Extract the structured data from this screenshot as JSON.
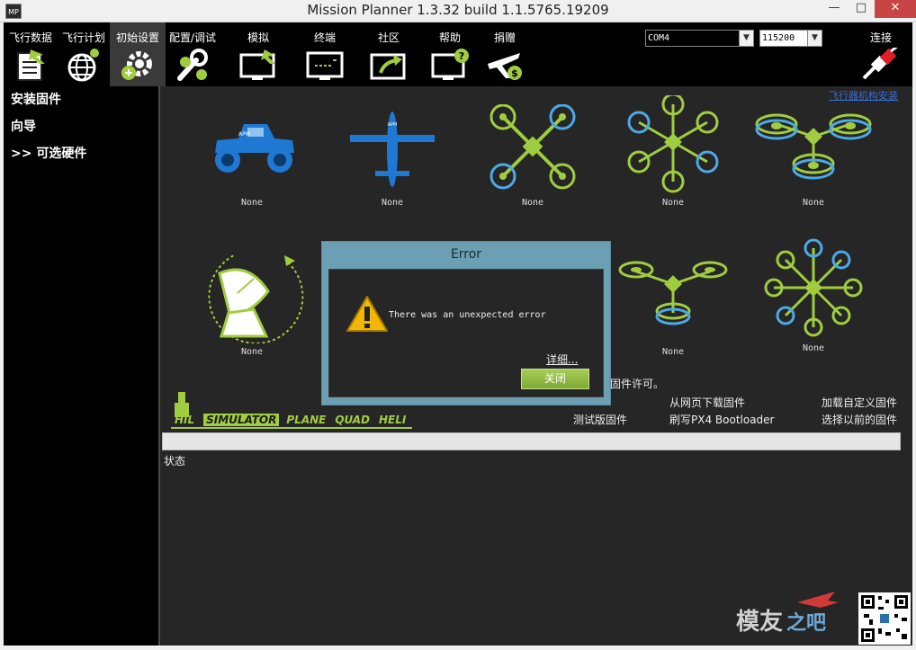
{
  "window": {
    "title": "Mission Planner 1.3.32 build 1.1.5765.19209",
    "app_icon_text": "MP"
  },
  "toolbar": {
    "items": [
      {
        "label": "飞行数据",
        "icon": "flight-data-icon"
      },
      {
        "label": "飞行计划",
        "icon": "flight-plan-icon"
      },
      {
        "label": "初始设置",
        "icon": "initial-setup-icon"
      },
      {
        "label": "配置/调试",
        "icon": "config-tuning-icon"
      },
      {
        "label": "模拟",
        "icon": "simulation-icon"
      },
      {
        "label": "终端",
        "icon": "terminal-icon"
      },
      {
        "label": "社区",
        "icon": "community-icon"
      },
      {
        "label": "帮助",
        "icon": "help-icon"
      },
      {
        "label": "捐赠",
        "icon": "donate-icon"
      }
    ],
    "port": "COM4",
    "baud": "115200",
    "connect_label": "连接"
  },
  "sidebar": {
    "items": [
      {
        "label": "安装固件"
      },
      {
        "label": "向导"
      },
      {
        "label": ">> 可选硬件"
      }
    ]
  },
  "main": {
    "help_link": "飞行器机构安装",
    "firmware": [
      {
        "name": "rover",
        "label": "None"
      },
      {
        "name": "plane",
        "label": "None"
      },
      {
        "name": "quad",
        "label": "None"
      },
      {
        "name": "hexa",
        "label": "None"
      },
      {
        "name": "y6",
        "label": "None"
      },
      {
        "name": "antenna-tracker",
        "label": "None"
      },
      {
        "name": "tri",
        "label": "None"
      },
      {
        "name": "octa",
        "label": "None"
      }
    ],
    "license_text": "固件许可。",
    "download_web": "从网页下载固件",
    "load_custom": "加载自定义固件",
    "beta": "测试版固件",
    "flash_px4": "刷写PX4 Bootloader",
    "previous": "选择以前的固件",
    "hil": {
      "hil": "HIL",
      "simulator": "SIMULATOR",
      "plane": "PLANE",
      "quad": "QUAD",
      "heli": "HELI"
    },
    "status_label": "状态"
  },
  "dialog": {
    "title": "Error",
    "message": "There was an unexpected error",
    "details": "详细...",
    "close": "关闭"
  },
  "colors": {
    "accent_green": "#9fcd3f",
    "accent_blue": "#1f78d1",
    "dialog_frame": "#6c9fb4"
  }
}
